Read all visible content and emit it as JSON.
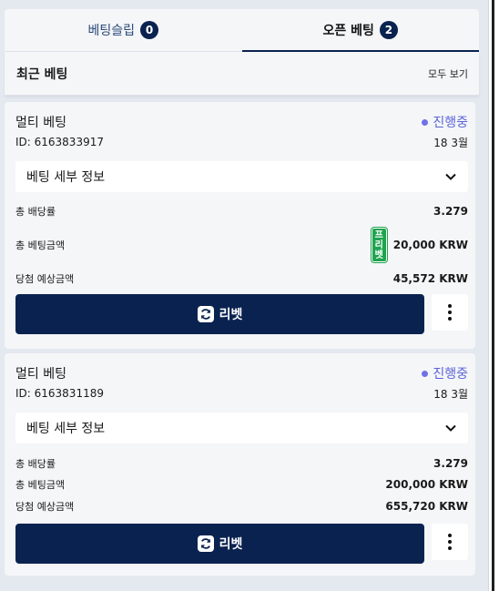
{
  "tabs": [
    {
      "label": "베팅슬립",
      "count": "0"
    },
    {
      "label": "오픈 베팅",
      "count": "2"
    }
  ],
  "recent": {
    "title": "최근 베팅",
    "view_all": "모두 보기"
  },
  "bets": [
    {
      "type": "멀티 베팅",
      "status": "진행중",
      "id": "ID: 6163833917",
      "date": "18 3월",
      "details_label": "베팅 세부 정보",
      "odds_label": "총 배당률",
      "odds": "3.279",
      "stake_label": "총 베팅금액",
      "free_badge": [
        "프",
        "리",
        "벳"
      ],
      "stake": "20,000 KRW",
      "payout_label": "당첨 예상금액",
      "payout": "45,572 KRW",
      "rebet_label": "리벳"
    },
    {
      "type": "멀티 베팅",
      "status": "진행중",
      "id": "ID: 6163831189",
      "date": "18 3월",
      "details_label": "베팅 세부 정보",
      "odds_label": "총 배당률",
      "odds": "3.279",
      "stake_label": "총 베팅금액",
      "stake": "200,000 KRW",
      "payout_label": "당첨 예상금액",
      "payout": "655,720 KRW",
      "rebet_label": "리벳"
    }
  ],
  "colors": {
    "navy": "#0a2250",
    "status": "#5b63d8",
    "free_bet": "#1ea34f"
  },
  "icons": [
    "chevron-down-icon",
    "refresh-icon",
    "more-vertical-icon"
  ]
}
